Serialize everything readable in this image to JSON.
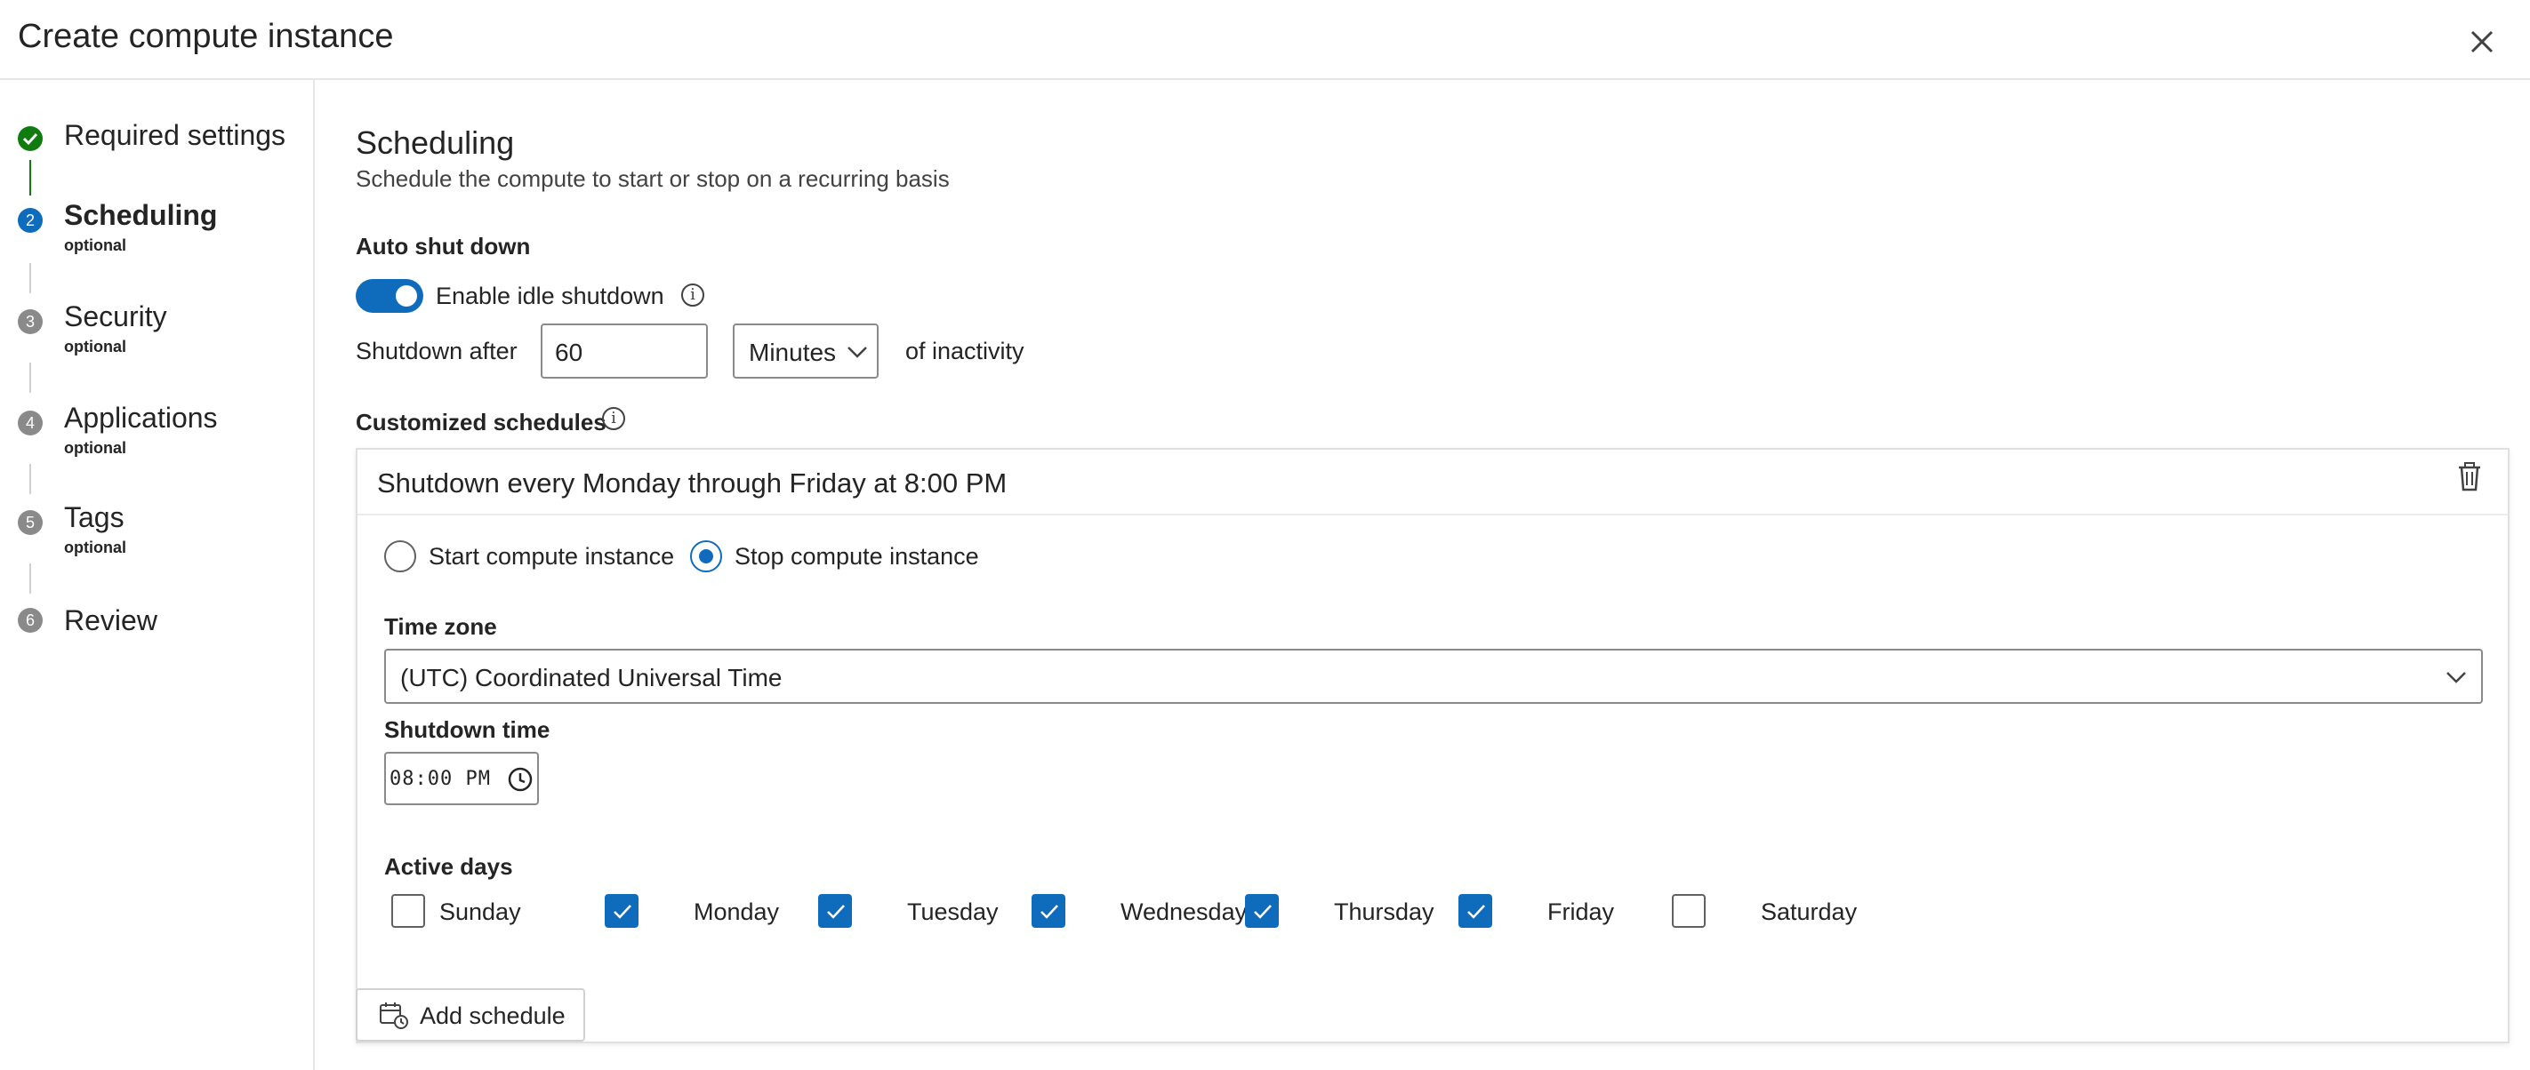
{
  "header": {
    "title": "Create compute instance"
  },
  "steps": [
    {
      "num": "✓",
      "label": "Required settings",
      "sub": "",
      "state": "done"
    },
    {
      "num": "2",
      "label": "Scheduling",
      "sub": "optional",
      "state": "current"
    },
    {
      "num": "3",
      "label": "Security",
      "sub": "optional",
      "state": "pending"
    },
    {
      "num": "4",
      "label": "Applications",
      "sub": "optional",
      "state": "pending"
    },
    {
      "num": "5",
      "label": "Tags",
      "sub": "optional",
      "state": "pending"
    },
    {
      "num": "6",
      "label": "Review",
      "sub": "",
      "state": "pending"
    }
  ],
  "main": {
    "title": "Scheduling",
    "description": "Schedule the compute to start or stop on a recurring basis",
    "auto_shutdown": {
      "heading": "Auto shut down",
      "toggle_label": "Enable idle shutdown",
      "toggle_on": true,
      "shutdown_after_label": "Shutdown after",
      "shutdown_after_value": "60",
      "unit": "Minutes",
      "suffix": "of inactivity"
    },
    "customized": {
      "heading": "Customized schedules",
      "schedule": {
        "title": "Shutdown every Monday through Friday at 8:00 PM",
        "start_label": "Start compute instance",
        "stop_label": "Stop compute instance",
        "selected": "stop",
        "timezone_label": "Time zone",
        "timezone_value": "(UTC) Coordinated Universal Time",
        "shutdown_time_label": "Shutdown time",
        "shutdown_time_value": "08:00 PM",
        "active_days_label": "Active days",
        "days": [
          {
            "label": "Sunday",
            "checked": false
          },
          {
            "label": "Monday",
            "checked": true
          },
          {
            "label": "Tuesday",
            "checked": true
          },
          {
            "label": "Wednesday",
            "checked": true
          },
          {
            "label": "Thursday",
            "checked": true
          },
          {
            "label": "Friday",
            "checked": true
          },
          {
            "label": "Saturday",
            "checked": false
          }
        ]
      }
    },
    "add_schedule_label": "Add schedule"
  },
  "colors": {
    "accent": "#0f6cbd",
    "success": "#107c10",
    "pending": "#8a8a8a"
  }
}
